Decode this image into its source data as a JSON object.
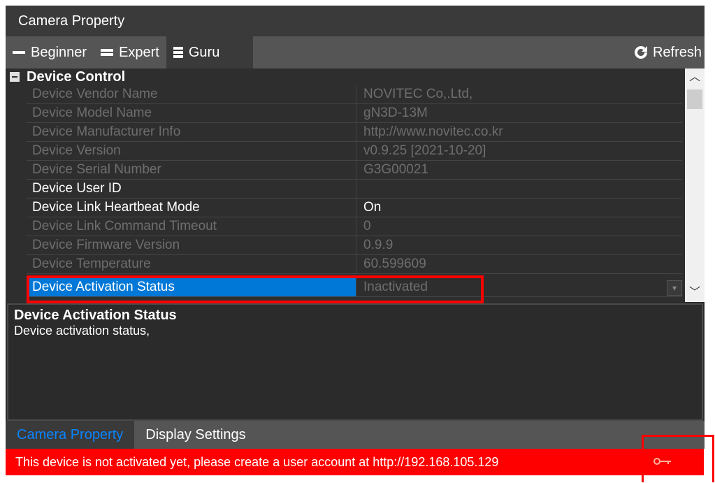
{
  "window": {
    "title": "Camera Property"
  },
  "toolbar": {
    "visibility": [
      {
        "label": "Beginner",
        "active": false
      },
      {
        "label": "Expert",
        "active": false
      },
      {
        "label": "Guru",
        "active": true
      }
    ],
    "refresh_label": "Refresh"
  },
  "grid": {
    "category": "Device Control",
    "rows": [
      {
        "name": "Device Vendor Name",
        "value": "NOVITEC Co,.Ltd,",
        "enabled": false
      },
      {
        "name": "Device Model Name",
        "value": "gN3D-13M",
        "enabled": false
      },
      {
        "name": "Device Manufacturer Info",
        "value": "http://www.novitec.co.kr",
        "enabled": false
      },
      {
        "name": "Device Version",
        "value": "v0.9.25 [2021-10-20]",
        "enabled": false
      },
      {
        "name": "Device Serial Number",
        "value": "G3G00021",
        "enabled": false
      },
      {
        "name": "Device User ID",
        "value": "",
        "enabled": true
      },
      {
        "name": "Device Link Heartbeat Mode",
        "value": "On",
        "enabled": true
      },
      {
        "name": "Device Link Command Timeout",
        "value": "0",
        "enabled": false
      },
      {
        "name": "Device Firmware Version",
        "value": "0.9.9",
        "enabled": false
      },
      {
        "name": "Device Temperature",
        "value": "60.599609",
        "enabled": false
      },
      {
        "name": "Device Activation Status",
        "value": "Inactivated",
        "enabled": false,
        "selected": true
      }
    ]
  },
  "description": {
    "title": "Device Activation Status",
    "text": "Device activation status,"
  },
  "bottom_tabs": [
    {
      "label": "Camera Property",
      "active": true
    },
    {
      "label": "Display Settings",
      "active": false
    }
  ],
  "status": {
    "message": "This device is not activated yet, please create a user account at http://192.168.105.129"
  },
  "colors": {
    "accent": "#0078d7",
    "alert": "#ff0000",
    "background": "#2e2e2e"
  }
}
